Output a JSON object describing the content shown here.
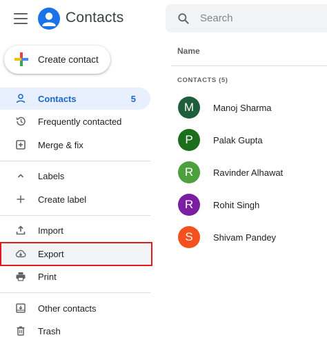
{
  "header": {
    "app_title": "Contacts",
    "menu_icon": "hamburger-menu-icon",
    "logo_icon": "person-circle-icon",
    "search": {
      "placeholder": "Search",
      "icon": "search-icon"
    }
  },
  "create_button": {
    "label": "Create contact",
    "icon": "colorful-plus-icon"
  },
  "sidebar": {
    "items": [
      {
        "label": "Contacts",
        "count": "5",
        "icon": "person-icon"
      },
      {
        "label": "Frequently contacted",
        "icon": "history-icon"
      },
      {
        "label": "Merge & fix",
        "icon": "merge-fix-icon"
      },
      {
        "label": "Labels",
        "icon": "chevron-up-icon"
      },
      {
        "label": "Create label",
        "icon": "plus-icon"
      },
      {
        "label": "Import",
        "icon": "upload-icon"
      },
      {
        "label": "Export",
        "icon": "cloud-download-icon"
      },
      {
        "label": "Print",
        "icon": "printer-icon"
      },
      {
        "label": "Other contacts",
        "icon": "inbox-icon"
      },
      {
        "label": "Trash",
        "icon": "trash-icon"
      }
    ]
  },
  "main": {
    "column_header": "Name",
    "section_label": "CONTACTS (5)",
    "contacts": [
      {
        "initial": "M",
        "name": "Manoj Sharma",
        "color": "#1e5e3a"
      },
      {
        "initial": "P",
        "name": "Palak Gupta",
        "color": "#1b6e1b"
      },
      {
        "initial": "R",
        "name": "Ravinder Alhawat",
        "color": "#4e9f3d"
      },
      {
        "initial": "R",
        "name": "Rohit Singh",
        "color": "#7b1fa2"
      },
      {
        "initial": "S",
        "name": "Shivam Pandey",
        "color": "#f4511e"
      }
    ]
  },
  "colors": {
    "accent": "#1a73e8",
    "active_bg": "#e8f0fe",
    "highlight_border": "#e21a1a"
  }
}
